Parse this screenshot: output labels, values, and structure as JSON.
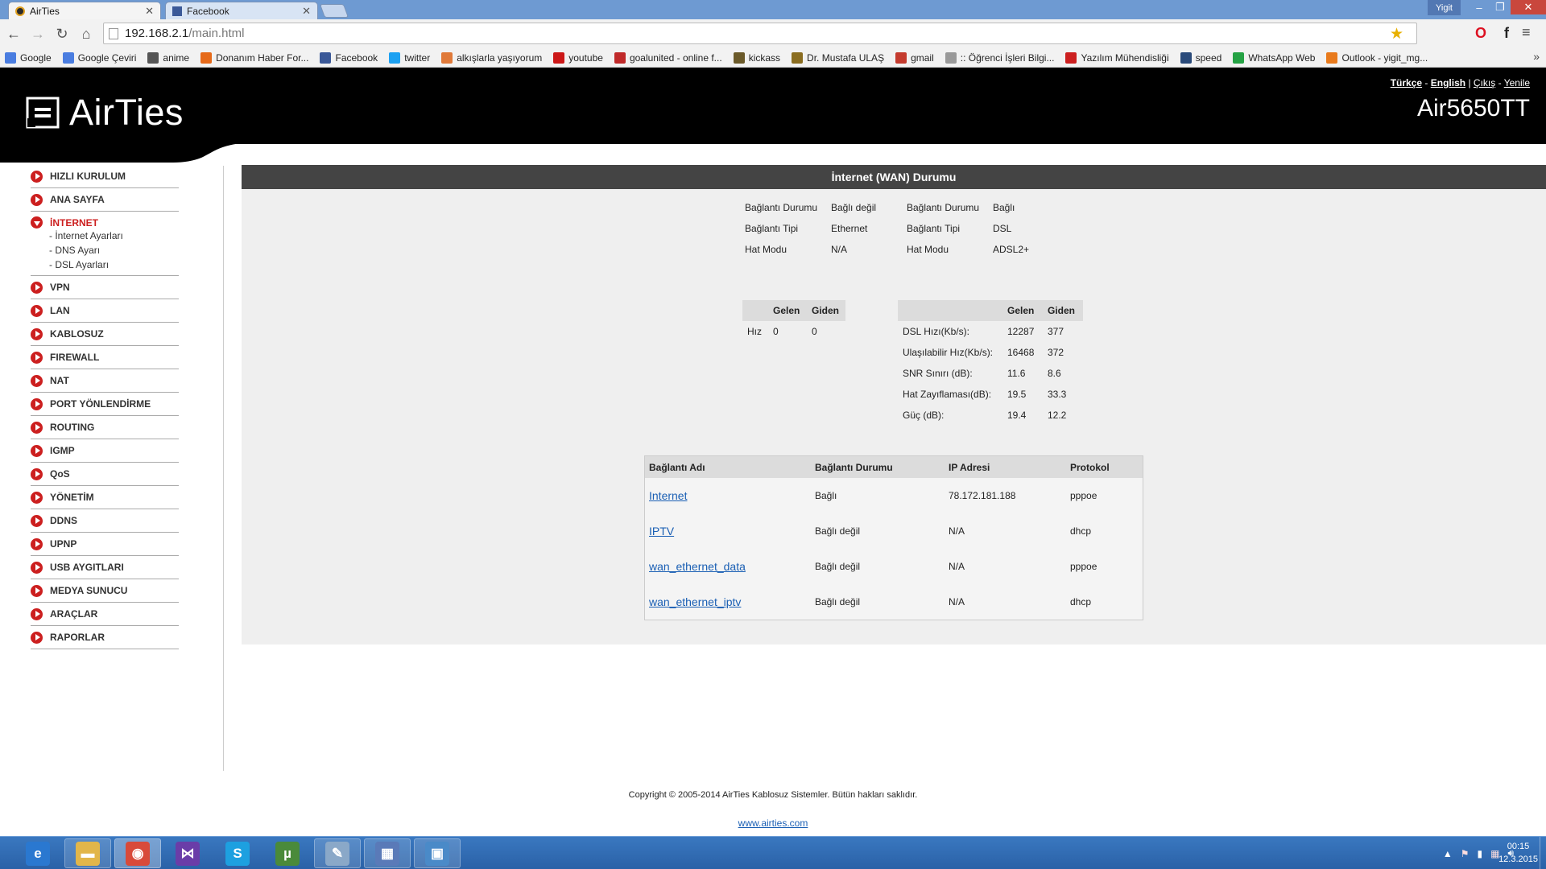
{
  "browser": {
    "tabs": [
      {
        "title": "AirTies",
        "active": true
      },
      {
        "title": "Facebook",
        "active": false
      }
    ],
    "user": "Yigit",
    "window_controls": {
      "minimize": "–",
      "maximize": "❐",
      "close": "✕"
    },
    "url": {
      "host": "192.168.2.1",
      "path": "/main.html"
    },
    "bookmarks": [
      {
        "label": "Google",
        "icon": "google-icon",
        "color": "#4a7de0"
      },
      {
        "label": "Google Çeviri",
        "icon": "translate-icon",
        "color": "#4a7de0"
      },
      {
        "label": "anime",
        "icon": "anime-icon",
        "color": "#555555"
      },
      {
        "label": "Donanım Haber For...",
        "icon": "dh-icon",
        "color": "#e66a1a"
      },
      {
        "label": "Facebook",
        "icon": "facebook-icon",
        "color": "#3b5998"
      },
      {
        "label": "twitter",
        "icon": "twitter-icon",
        "color": "#1da1f2"
      },
      {
        "label": "alkışlarla yaşıyorum",
        "icon": "alkis-icon",
        "color": "#e07a3a"
      },
      {
        "label": "youtube",
        "icon": "youtube-icon",
        "color": "#cc1818"
      },
      {
        "label": "goalunited - online f...",
        "icon": "goalunited-icon",
        "color": "#c02a2a"
      },
      {
        "label": "kickass",
        "icon": "kickass-icon",
        "color": "#6b5a2a"
      },
      {
        "label": "Dr. Mustafa ULAŞ",
        "icon": "mu-icon",
        "color": "#8a6d20"
      },
      {
        "label": "gmail",
        "icon": "gmail-icon",
        "color": "#c43b2e"
      },
      {
        "label": ":: Öğrenci İşleri Bilgi...",
        "icon": "page-icon",
        "color": "#999999"
      },
      {
        "label": "Yazılım Mühendisliği",
        "icon": "yazilim-icon",
        "color": "#cc2020"
      },
      {
        "label": "speed",
        "icon": "speed-icon",
        "color": "#2a4a7a"
      },
      {
        "label": "WhatsApp Web",
        "icon": "whatsapp-icon",
        "color": "#25a244"
      },
      {
        "label": "Outlook - yigit_mg...",
        "icon": "outlook-icon",
        "color": "#e87a1c"
      }
    ],
    "bookmarks_more": "»"
  },
  "header": {
    "logo_text": "AirTies",
    "lang_tr": "Türkçe",
    "lang_sep": "-",
    "lang_en": "English",
    "sep": "|",
    "logout": "Çıkış",
    "refresh": "Yenile",
    "model": "Air5650TT"
  },
  "sidebar": {
    "items": [
      {
        "label": "HIZLI KURULUM"
      },
      {
        "label": "ANA SAYFA"
      },
      {
        "label": "İNTERNET",
        "open": true,
        "sub": [
          "- İnternet Ayarları",
          "- DNS Ayarı",
          "- DSL Ayarları"
        ]
      },
      {
        "label": "VPN"
      },
      {
        "label": "LAN"
      },
      {
        "label": "KABLOSUZ"
      },
      {
        "label": "FIREWALL"
      },
      {
        "label": "NAT"
      },
      {
        "label": "PORT YÖNLENDİRME"
      },
      {
        "label": "ROUTING"
      },
      {
        "label": "IGMP"
      },
      {
        "label": "QoS"
      },
      {
        "label": "YÖNETİM"
      },
      {
        "label": "DDNS"
      },
      {
        "label": "UPNP"
      },
      {
        "label": "USB AYGITLARI"
      },
      {
        "label": "MEDYA SUNUCU"
      },
      {
        "label": "ARAÇLAR"
      },
      {
        "label": "RAPORLAR"
      }
    ]
  },
  "content": {
    "title": "İnternet (WAN) Durumu",
    "status_left": [
      {
        "label": "Bağlantı Durumu",
        "value": "Bağlı değil"
      },
      {
        "label": "Bağlantı Tipi",
        "value": "Ethernet"
      },
      {
        "label": "Hat Modu",
        "value": "N/A"
      }
    ],
    "status_right": [
      {
        "label": "Bağlantı Durumu",
        "value": "Bağlı"
      },
      {
        "label": "Bağlantı Tipi",
        "value": "DSL"
      },
      {
        "label": "Hat Modu",
        "value": "ADSL2+"
      }
    ],
    "speed_table": {
      "headers": [
        "",
        "Gelen",
        "Giden"
      ],
      "rows": [
        [
          "Hız",
          "0",
          "0"
        ]
      ]
    },
    "dsl_table": {
      "headers": [
        "",
        "Gelen",
        "Giden"
      ],
      "rows": [
        [
          "DSL Hızı(Kb/s):",
          "12287",
          "377"
        ],
        [
          "Ulaşılabilir Hız(Kb/s):",
          "16468",
          "372"
        ],
        [
          "SNR Sınırı (dB):",
          "11.6",
          "8.6"
        ],
        [
          "Hat Zayıflaması(dB):",
          "19.5",
          "33.3"
        ],
        [
          "Güç (dB):",
          "19.4",
          "12.2"
        ]
      ]
    },
    "connections": {
      "headers": [
        "Bağlantı Adı",
        "Bağlantı Durumu",
        "IP Adresi",
        "Protokol"
      ],
      "rows": [
        [
          "Internet",
          "Bağlı",
          "78.172.181.188",
          "pppoe"
        ],
        [
          "IPTV",
          "Bağlı değil",
          "N/A",
          "dhcp"
        ],
        [
          "wan_ethernet_data",
          "Bağlı değil",
          "N/A",
          "pppoe"
        ],
        [
          "wan_ethernet_iptv",
          "Bağlı değil",
          "N/A",
          "dhcp"
        ]
      ]
    }
  },
  "footer": {
    "copyright": "Copyright © 2005-2014 AirTies Kablosuz Sistemler. Bütün hakları saklıdır.",
    "link": "www.airties.com"
  },
  "taskbar": {
    "apps": [
      {
        "name": "internet-explorer-icon",
        "glyph": "e",
        "color": "#2a78d0",
        "pinned": false
      },
      {
        "name": "file-explorer-icon",
        "glyph": "▬",
        "color": "#e2b64a",
        "pinned": true
      },
      {
        "name": "chrome-icon",
        "glyph": "◉",
        "color": "#d84a3a",
        "pinned": true,
        "active": true
      },
      {
        "name": "visual-studio-icon",
        "glyph": "⋈",
        "color": "#6a3da8",
        "pinned": false
      },
      {
        "name": "skype-icon",
        "glyph": "S",
        "color": "#1da0e0",
        "pinned": false
      },
      {
        "name": "utorrent-icon",
        "glyph": "µ",
        "color": "#4a8a3a",
        "pinned": false
      },
      {
        "name": "notepad-icon",
        "glyph": "✎",
        "color": "#8aa8c8",
        "pinned": true
      },
      {
        "name": "remote-desktop-icon",
        "glyph": "▦",
        "color": "#5a7ab8",
        "pinned": true
      },
      {
        "name": "image-viewer-icon",
        "glyph": "▣",
        "color": "#4a8ac8",
        "pinned": true
      }
    ],
    "clock_time": "00:15",
    "clock_date": "12.3.2015"
  },
  "colors": {
    "accent_red": "#cc1f1f",
    "header_black": "#000000",
    "title_bar": "#444444",
    "link_blue": "#1a5fb4"
  }
}
